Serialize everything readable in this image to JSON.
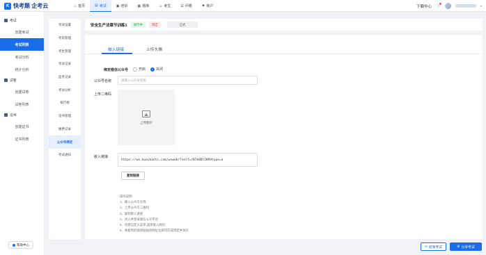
{
  "brand": {
    "logo_text": "快考题 企考云"
  },
  "nav": [
    {
      "label": "首页",
      "icon": "home-icon"
    },
    {
      "label": "考试",
      "icon": "exam-icon"
    },
    {
      "label": "培训",
      "icon": "training-icon"
    },
    {
      "label": "题库",
      "icon": "question-bank-icon"
    },
    {
      "label": "考生",
      "icon": "candidate-icon"
    },
    {
      "label": "问卷",
      "icon": "survey-icon"
    },
    {
      "label": "账户",
      "icon": "account-icon"
    }
  ],
  "top_right": {
    "download": "下载中心"
  },
  "sidebar": {
    "groups": [
      {
        "title": "考试",
        "items": [
          "创建考试",
          "考试列表",
          "考试分析",
          "统计分析"
        ]
      },
      {
        "title": "试卷",
        "items": [
          "创建试卷",
          "试卷列表"
        ]
      },
      {
        "title": "证书",
        "items": [
          "创建证书",
          "证书列表"
        ]
      }
    ],
    "active_item": "考试列表",
    "help": "帮助中心"
  },
  "subnav": {
    "items": [
      "考试设置",
      "考前管理",
      "考生管理",
      "考试记录",
      "监考记录",
      "考试分析",
      "排行榜",
      "证书管理",
      "缴费记录",
      "公众号绑定",
      "考试通知"
    ],
    "active": "公众号绑定"
  },
  "header": {
    "exam_title": "安全生产法章节训练1",
    "status_tag": "进行中",
    "mode_tag": "限定",
    "type_tag": "正式"
  },
  "tabs": [
    {
      "label": "嵌入链接"
    },
    {
      "label": "上传头像"
    }
  ],
  "form": {
    "bind_label": "绑定微信公众号",
    "radio_on": "开启",
    "radio_off": "关闭",
    "selected": "关闭",
    "name_label": "公众号名称",
    "name_placeholder": "请输入公众号名称",
    "qr_label": "上传二维码",
    "upload_text": "上传图片",
    "link_label": "嵌入链接",
    "link_value": "https://wx.kuaikaoti.com/wxweb/?self=rB7k8Dt1KM4type=a",
    "copy_button": "复制链接"
  },
  "steps": {
    "title": "操作说明",
    "items": [
      "1、输入公众号名称",
      "2、上传公众号二维码",
      "3、复制嵌入链接",
      "4、进入并登录微信公众平台",
      "5、创建自定义菜单,选择嵌入网页",
      "6、将复制的链接粘贴到网址位即可完成绑定并保存"
    ]
  },
  "footer": {
    "end_button": "结束考试",
    "share_button": "分享考试"
  },
  "colors": {
    "accent": "#1a6ce8",
    "status_green": "#27a84a",
    "status_red": "#e0443e"
  }
}
